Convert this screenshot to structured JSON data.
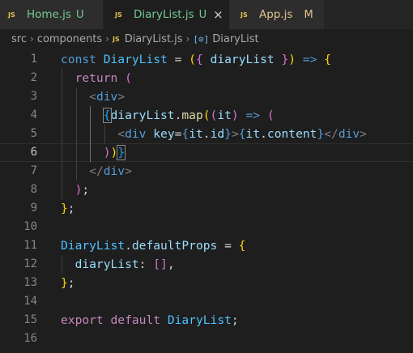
{
  "tabs": [
    {
      "name": "Home.js",
      "status": "U",
      "icon": "js-file-icon",
      "active": false
    },
    {
      "name": "DiaryList.js",
      "status": "U",
      "icon": "js-file-icon",
      "active": true,
      "close": "×"
    },
    {
      "name": "App.js",
      "status": "M",
      "icon": "js-file-icon",
      "active": false
    }
  ],
  "icons": {
    "js": "JS",
    "symbol": "[⊙]"
  },
  "breadcrumb": {
    "parts": [
      "src",
      "components",
      "DiaryList.js",
      "DiaryList"
    ],
    "separator": "›"
  },
  "editor": {
    "current_line": 6,
    "lines": [
      {
        "n": "1",
        "tokens": [
          [
            "kw",
            "const"
          ],
          [
            "p",
            " "
          ],
          [
            "var",
            "DiaryList"
          ],
          [
            "p",
            " = "
          ],
          [
            "br",
            "("
          ],
          [
            "br2",
            "{"
          ],
          [
            "p",
            " "
          ],
          [
            "prop",
            "diaryList"
          ],
          [
            "p",
            " "
          ],
          [
            "br2",
            "}"
          ],
          [
            "br",
            ")"
          ],
          [
            "p",
            " "
          ],
          [
            "kw",
            "=>"
          ],
          [
            "p",
            " "
          ],
          [
            "br",
            "{"
          ]
        ]
      },
      {
        "n": "2",
        "tokens": [
          [
            "p",
            "  "
          ],
          [
            "ctrl",
            "return"
          ],
          [
            "p",
            " "
          ],
          [
            "br2",
            "("
          ]
        ]
      },
      {
        "n": "3",
        "tokens": [
          [
            "p",
            "    "
          ],
          [
            "ang",
            "<"
          ],
          [
            "tag",
            "div"
          ],
          [
            "ang",
            ">"
          ]
        ]
      },
      {
        "n": "4",
        "tokens": [
          [
            "p",
            "      "
          ],
          [
            "br3bm",
            "{"
          ],
          [
            "prop",
            "diaryList"
          ],
          [
            "p",
            "."
          ],
          [
            "fn",
            "map"
          ],
          [
            "br",
            "("
          ],
          [
            "br2",
            "("
          ],
          [
            "prop",
            "it"
          ],
          [
            "br2",
            ")"
          ],
          [
            "p",
            " "
          ],
          [
            "kw",
            "=>"
          ],
          [
            "p",
            " "
          ],
          [
            "br2",
            "("
          ]
        ]
      },
      {
        "n": "5",
        "tokens": [
          [
            "p",
            "        "
          ],
          [
            "ang",
            "<"
          ],
          [
            "tag",
            "div"
          ],
          [
            "p",
            " "
          ],
          [
            "attr",
            "key"
          ],
          [
            "p",
            "="
          ],
          [
            "kw",
            "{"
          ],
          [
            "prop",
            "it"
          ],
          [
            "p",
            "."
          ],
          [
            "prop",
            "id"
          ],
          [
            "kw",
            "}"
          ],
          [
            "ang",
            ">"
          ],
          [
            "kw",
            "{"
          ],
          [
            "prop",
            "it"
          ],
          [
            "p",
            "."
          ],
          [
            "prop",
            "content"
          ],
          [
            "kw",
            "}"
          ],
          [
            "ang",
            "</"
          ],
          [
            "tag",
            "div"
          ],
          [
            "ang",
            ">"
          ]
        ]
      },
      {
        "n": "6",
        "tokens": [
          [
            "p",
            "      "
          ],
          [
            "br2",
            ")"
          ],
          [
            "br",
            ")"
          ],
          [
            "br3bm",
            "}"
          ]
        ]
      },
      {
        "n": "7",
        "tokens": [
          [
            "p",
            "    "
          ],
          [
            "ang",
            "</"
          ],
          [
            "tag",
            "div"
          ],
          [
            "ang",
            ">"
          ]
        ]
      },
      {
        "n": "8",
        "tokens": [
          [
            "p",
            "  "
          ],
          [
            "br2",
            ")"
          ],
          [
            "p",
            ";"
          ]
        ]
      },
      {
        "n": "9",
        "tokens": [
          [
            "br",
            "}"
          ],
          [
            "p",
            ";"
          ]
        ]
      },
      {
        "n": "10",
        "tokens": []
      },
      {
        "n": "11",
        "tokens": [
          [
            "var",
            "DiaryList"
          ],
          [
            "p",
            "."
          ],
          [
            "prop",
            "defaultProps"
          ],
          [
            "p",
            " = "
          ],
          [
            "br",
            "{"
          ]
        ]
      },
      {
        "n": "12",
        "tokens": [
          [
            "p",
            "  "
          ],
          [
            "prop",
            "diaryList"
          ],
          [
            "p",
            ": "
          ],
          [
            "br2",
            "[]"
          ],
          [
            "p",
            ","
          ]
        ]
      },
      {
        "n": "13",
        "tokens": [
          [
            "br",
            "}"
          ],
          [
            "p",
            ";"
          ]
        ]
      },
      {
        "n": "14",
        "tokens": []
      },
      {
        "n": "15",
        "tokens": [
          [
            "ctrl",
            "export"
          ],
          [
            "p",
            " "
          ],
          [
            "ctrl",
            "default"
          ],
          [
            "p",
            " "
          ],
          [
            "var",
            "DiaryList"
          ],
          [
            "p",
            ";"
          ]
        ]
      },
      {
        "n": "16",
        "tokens": []
      }
    ]
  },
  "colors": {
    "background": "#1e1e1e",
    "tabbar": "#252526",
    "js_icon": "#e2c04a",
    "untracked": "#73c991",
    "modified": "#e2c08d"
  }
}
